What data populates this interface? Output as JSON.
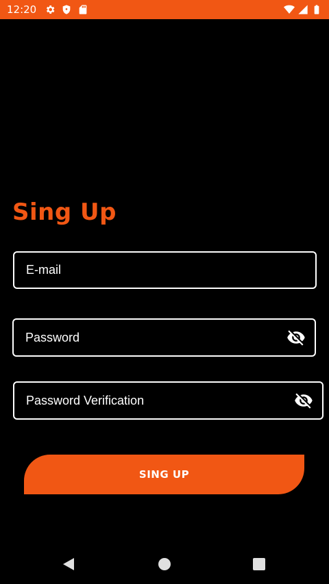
{
  "status_bar": {
    "time": "12:20",
    "background": "#f15714",
    "left_icons": [
      "gear-icon",
      "shield-icon",
      "sd-card-icon"
    ],
    "right_icons": [
      "wifi-icon",
      "signal-icon",
      "battery-icon"
    ]
  },
  "page": {
    "title": "Sing Up",
    "accent_color": "#f15714",
    "background": "#000000"
  },
  "form": {
    "email": {
      "placeholder": "E-mail",
      "value": ""
    },
    "password": {
      "placeholder": "Password",
      "value": "",
      "toggle_icon": "eye-off-icon"
    },
    "password_verification": {
      "placeholder": "Password Verification",
      "value": "",
      "toggle_icon": "eye-off-icon"
    },
    "submit_label": "SING UP"
  },
  "nav_bar": {
    "buttons": [
      "back-icon",
      "home-icon",
      "recents-icon"
    ]
  }
}
